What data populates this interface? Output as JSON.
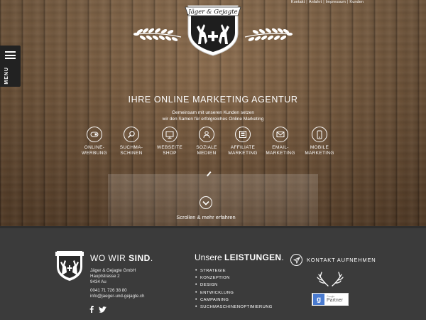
{
  "top_links": [
    "Kontakt",
    "Anfahrt",
    "Impressum",
    "Kunden"
  ],
  "menu": {
    "label": "MENU"
  },
  "logo": {
    "text": "Jäger & Gejagte"
  },
  "hero": {
    "headline": "IHRE ONLINE MARKETING AGENTUR",
    "sub_line1": "Gemeinsam mit unseren Kunden setzen",
    "sub_line2": "wir den Samen für erfolgreiches Online Marketing"
  },
  "services": [
    {
      "line1": "ONLINE-",
      "line2": "WERBUNG",
      "icon": "online-ad-icon"
    },
    {
      "line1": "SUCHMA-",
      "line2": "SCHINEN",
      "icon": "search-icon"
    },
    {
      "line1": "WEBSEITE",
      "line2": "SHOP",
      "icon": "monitor-icon"
    },
    {
      "line1": "SOZIALE",
      "line2": "MEDIEN",
      "icon": "people-icon"
    },
    {
      "line1": "AFFILIATE",
      "line2": "MARKETING",
      "icon": "affiliate-icon"
    },
    {
      "line1": "EMAIL-",
      "line2": "MARKETING",
      "icon": "email-icon"
    },
    {
      "line1": "MOBILE",
      "line2": "MARKETING",
      "icon": "mobile-icon"
    }
  ],
  "scroll": {
    "label": "Scrollen & mehr erfahren"
  },
  "footer": {
    "col1_title_a": "WO WIR ",
    "col1_title_b": "SIND",
    "col1_title_dot": ".",
    "address": [
      "Jäger & Gejagte GmbH",
      "Hauptstrasse 2",
      "9434 Au"
    ],
    "phone": "0041 71 726 38 80",
    "email": "info@jaeger-und-gejagte.ch",
    "col2_title_a": "Unsere ",
    "col2_title_b": "LEISTUNGEN",
    "col2_title_dot": ".",
    "services": [
      "STRATEGIE",
      "KONZEPTION",
      "DESIGN",
      "ENTWICKLUNG",
      "CAMPAINING",
      "SUCHMASCHINENOPTIMIERUNG"
    ],
    "contact_label": "KONTAKT AUFNEHMEN",
    "partner_small": "Google",
    "partner_big": "Partner"
  },
  "colors": {
    "wood": "#7e5e3f",
    "footer_bg": "#3b3b3b",
    "menu_bg": "#222222",
    "google_blue": "#4a7bd0"
  }
}
